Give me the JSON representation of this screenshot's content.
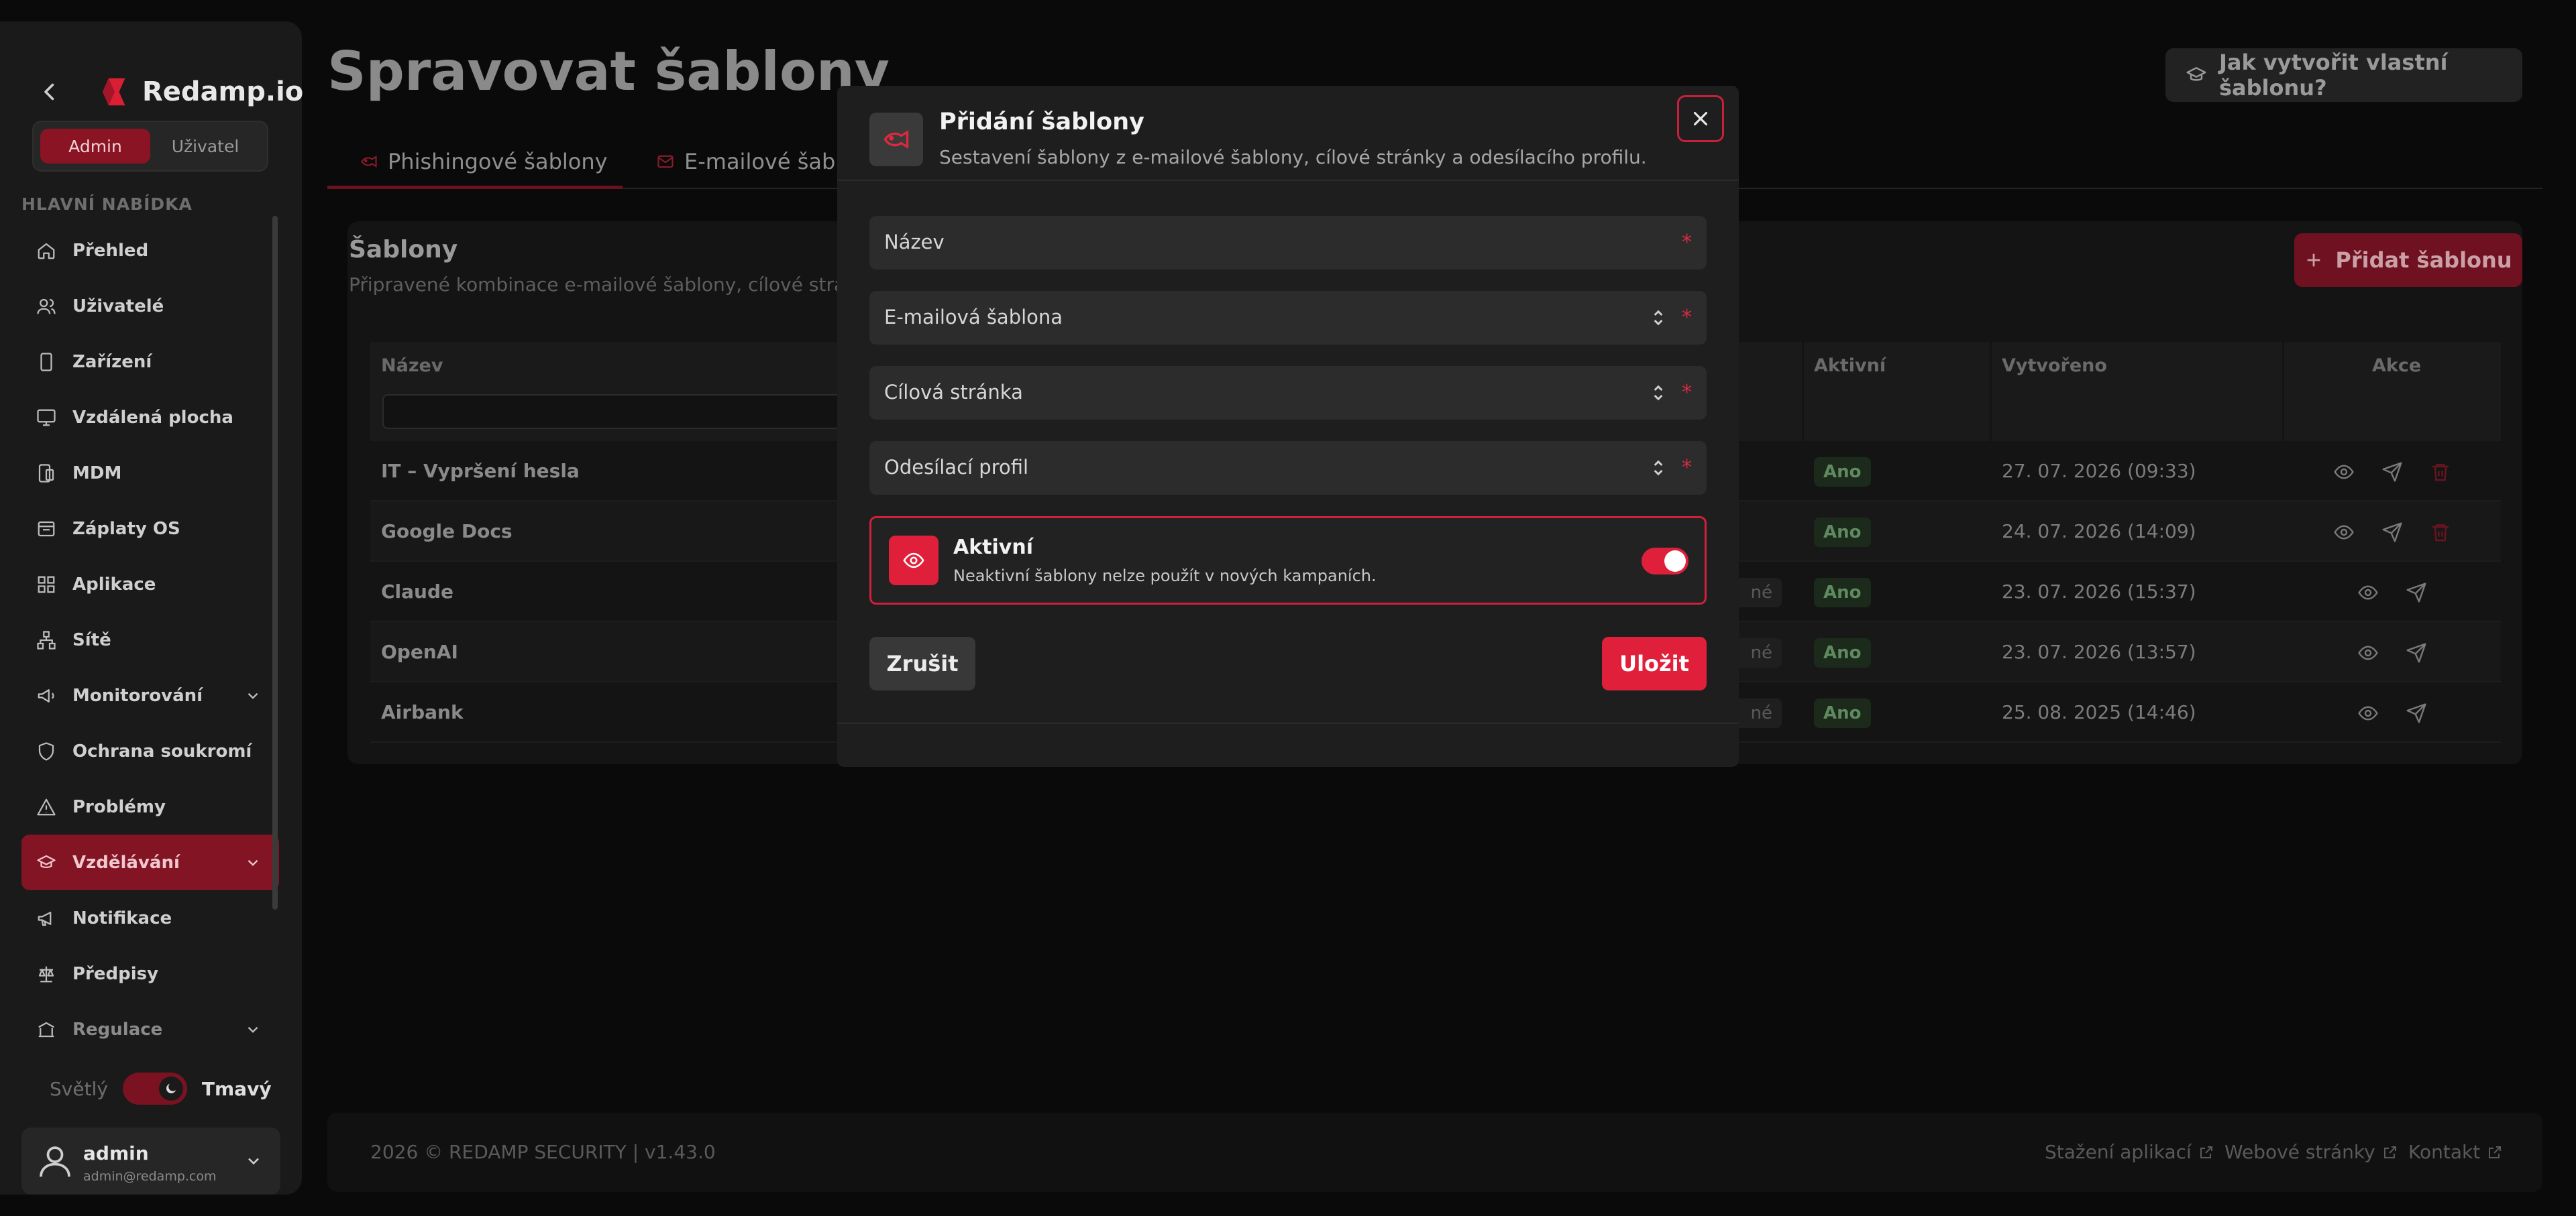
{
  "app": {
    "brand": "Redamp.io",
    "accent": "#e0203a"
  },
  "sidebar": {
    "roles": [
      "Admin",
      "Uživatel"
    ],
    "active_role": "Admin",
    "section_title": "HLAVNÍ NABÍDKA",
    "items": [
      {
        "label": "Přehled",
        "icon": "home-icon"
      },
      {
        "label": "Uživatelé",
        "icon": "users-icon"
      },
      {
        "label": "Zařízení",
        "icon": "phone-icon"
      },
      {
        "label": "Vzdálená plocha",
        "icon": "monitor-icon"
      },
      {
        "label": "MDM",
        "icon": "devices-icon"
      },
      {
        "label": "Záplaty OS",
        "icon": "patch-icon"
      },
      {
        "label": "Aplikace",
        "icon": "grid-icon"
      },
      {
        "label": "Sítě",
        "icon": "network-icon"
      },
      {
        "label": "Monitorování",
        "icon": "megaphone-icon",
        "expandable": true
      },
      {
        "label": "Ochrana soukromí",
        "icon": "shield-icon"
      },
      {
        "label": "Problémy",
        "icon": "warning-icon"
      },
      {
        "label": "Vzdělávání",
        "icon": "graduation-icon",
        "expandable": true,
        "active": true
      },
      {
        "label": "Notifikace",
        "icon": "bullhorn-icon"
      },
      {
        "label": "Předpisy",
        "icon": "scale-icon"
      },
      {
        "label": "Regulace",
        "icon": "regulation-icon",
        "expandable": true
      }
    ],
    "theme": {
      "light": "Světlý",
      "dark": "Tmavý",
      "current": "dark"
    },
    "user": {
      "name": "admin",
      "email": "admin@redamp.com"
    }
  },
  "page": {
    "title": "Spravovat šablony",
    "help_button": "Jak vytvořit vlastní šablonu?",
    "tabs": [
      {
        "label": "Phishingové šablony",
        "active": true
      },
      {
        "label": "E-mailové šablo"
      }
    ],
    "panel": {
      "title": "Šablony",
      "subtitle": "Připravené kombinace e-mailové šablony, cílové stránky",
      "add_button": "Přidat šablonu"
    },
    "table": {
      "headers": {
        "name": "Název",
        "active": "Aktivní",
        "created": "Vytvořeno",
        "actions": "Akce"
      },
      "rows": [
        {
          "name": "IT – Vypršení hesla",
          "active": "Ano",
          "created": "27. 07. 2026 (09:33)",
          "deletable": true,
          "tag": ""
        },
        {
          "name": "Google Docs",
          "active": "Ano",
          "created": "24. 07. 2026 (14:09)",
          "deletable": true,
          "tag": ""
        },
        {
          "name": "Claude",
          "active": "Ano",
          "created": "23. 07. 2026 (15:37)",
          "deletable": false,
          "tag": "né"
        },
        {
          "name": "OpenAI",
          "active": "Ano",
          "created": "23. 07. 2026 (13:57)",
          "deletable": false,
          "tag": "né"
        },
        {
          "name": "Airbank",
          "active": "Ano",
          "created": "25. 08. 2025 (14:46)",
          "deletable": false,
          "tag": "né"
        }
      ]
    },
    "footer": {
      "copyright": "2026 © REDAMP SECURITY | v1.43.0",
      "links": [
        "Stažení aplikací",
        "Webové stránky",
        "Kontakt"
      ]
    }
  },
  "modal": {
    "title": "Přidání šablony",
    "subtitle": "Sestavení šablony z e-mailové šablony, cílové stránky a odesílacího profilu.",
    "fields": [
      {
        "label": "Název",
        "type": "text",
        "required": true
      },
      {
        "label": "E-mailová šablona",
        "type": "select",
        "required": true
      },
      {
        "label": "Cílová stránka",
        "type": "select",
        "required": true
      },
      {
        "label": "Odesílací profil",
        "type": "select",
        "required": true
      }
    ],
    "required_mark": "*",
    "active": {
      "title": "Aktivní",
      "description": "Neaktivní šablony nelze použít v nových kampaních.",
      "enabled": true
    },
    "cancel": "Zrušit",
    "save": "Uložit"
  }
}
